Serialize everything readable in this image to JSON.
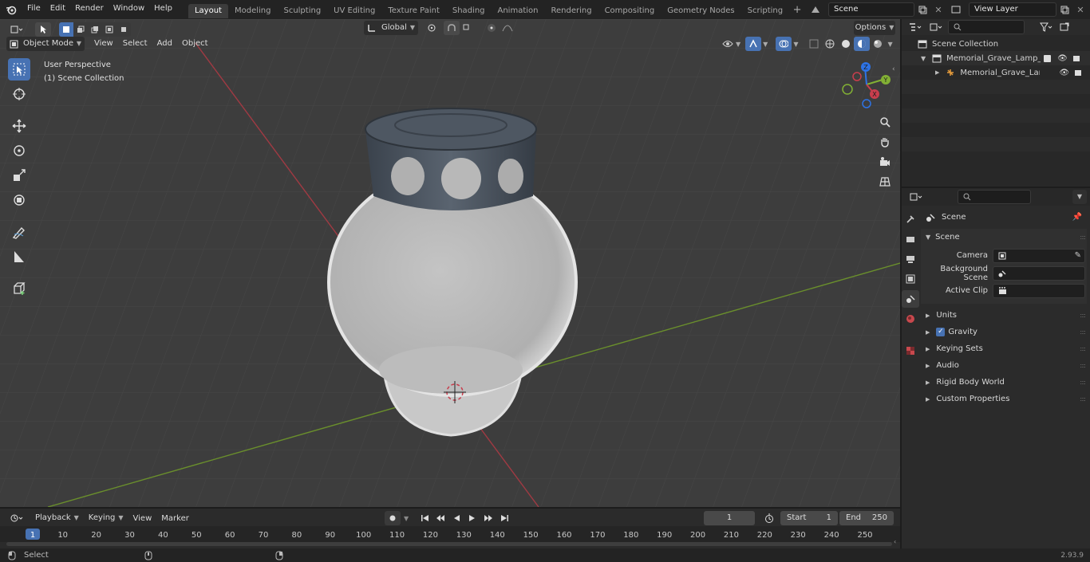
{
  "menus": [
    "File",
    "Edit",
    "Render",
    "Window",
    "Help"
  ],
  "workspaces": [
    "Layout",
    "Modeling",
    "Sculpting",
    "UV Editing",
    "Texture Paint",
    "Shading",
    "Animation",
    "Rendering",
    "Compositing",
    "Geometry Nodes",
    "Scripting"
  ],
  "active_workspace": "Layout",
  "scene_field": "Scene",
  "view_layer_field": "View Layer",
  "viewport": {
    "mode": "Object Mode",
    "menu": [
      "View",
      "Select",
      "Add",
      "Object"
    ],
    "orientation": "Global",
    "options_label": "Options",
    "overlay_title": "User Perspective",
    "overlay_collection": "(1) Scene Collection",
    "gizmo_axes": {
      "x": "X",
      "y": "Y",
      "z": "Z"
    }
  },
  "outliner": {
    "root": "Scene Collection",
    "items": [
      {
        "label": "Memorial_Grave_Lamp_No_C"
      },
      {
        "label": "Memorial_Grave_Lamp_N"
      }
    ]
  },
  "properties": {
    "context": "Scene",
    "panel_title": "Scene",
    "camera_label": "Camera",
    "bg_scene_label": "Background Scene",
    "active_clip_label": "Active Clip",
    "sections": [
      "Units",
      "Gravity",
      "Keying Sets",
      "Audio",
      "Rigid Body World",
      "Custom Properties"
    ]
  },
  "timeline": {
    "menus": [
      "Playback",
      "Keying",
      "View",
      "Marker"
    ],
    "current_frame": "1",
    "start_label": "Start",
    "start_value": "1",
    "end_label": "End",
    "end_value": "250",
    "ticks": [
      "1",
      "10",
      "20",
      "30",
      "40",
      "50",
      "60",
      "70",
      "80",
      "90",
      "100",
      "110",
      "120",
      "130",
      "140",
      "150",
      "160",
      "170",
      "180",
      "190",
      "200",
      "210",
      "220",
      "230",
      "240",
      "250"
    ]
  },
  "status": {
    "left": "Select",
    "version": "2.93.9"
  },
  "colors": {
    "accent": "#4772b3",
    "x_axis": "#c83e4d",
    "y_axis": "#82b034",
    "z_axis": "#2e73e6"
  }
}
